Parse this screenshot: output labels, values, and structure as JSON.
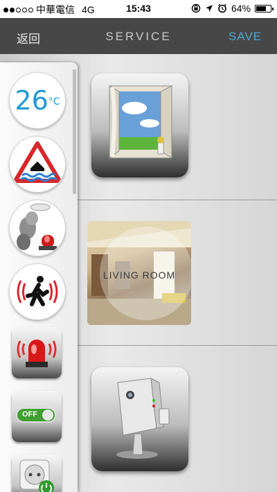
{
  "status_bar": {
    "carrier": "中華電信",
    "network": "4G",
    "time": "15:43",
    "battery": "64%",
    "battery_level": 0.64
  },
  "nav": {
    "back_label": "返回",
    "title": "SERVICE",
    "save_label": "SAVE"
  },
  "sidebar": {
    "temperature_value": "26",
    "temperature_unit": "°C",
    "toggle_label": "OFF",
    "items": [
      {
        "icon": "thermometer-icon"
      },
      {
        "icon": "flood-warning-icon"
      },
      {
        "icon": "smoke-alarm-icon"
      },
      {
        "icon": "motion-sensor-icon"
      },
      {
        "icon": "siren-icon"
      },
      {
        "icon": "switch-icon"
      },
      {
        "icon": "power-outlet-icon"
      }
    ]
  },
  "main": {
    "room_label": "LIVING ROOM"
  },
  "colors": {
    "accent": "#4ba5d8",
    "navbar": "#474747",
    "temperature": "#1f9ad6",
    "toggle_green": "#3f9f2f"
  }
}
